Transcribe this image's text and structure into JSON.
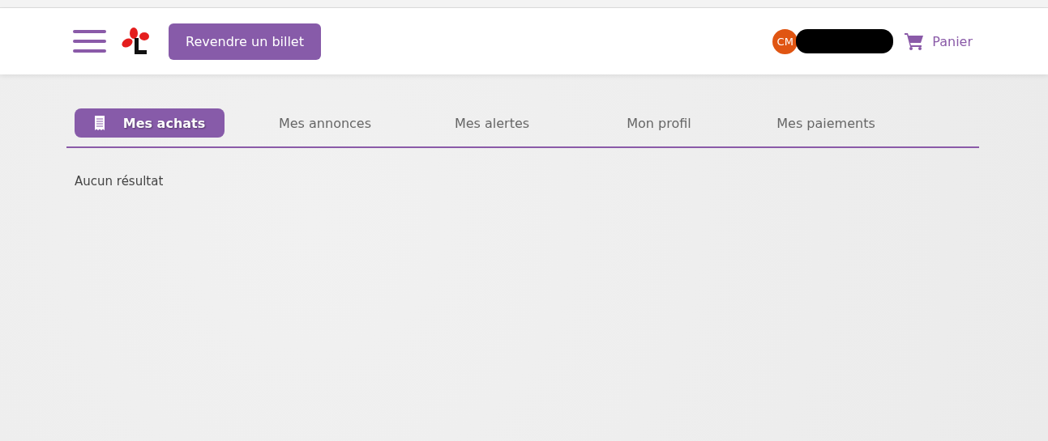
{
  "header": {
    "resell_button": "Revendre un billet",
    "user": {
      "initials": "CM"
    },
    "cart": "Panier"
  },
  "tabs": [
    {
      "label": "Mes achats",
      "selected": true
    },
    {
      "label": "Mes annonces",
      "selected": false
    },
    {
      "label": "Mes alertes",
      "selected": false
    },
    {
      "label": "Mon profil",
      "selected": false
    },
    {
      "label": "Mes paiements",
      "selected": false
    }
  ],
  "empty_message": "Aucun résultat"
}
